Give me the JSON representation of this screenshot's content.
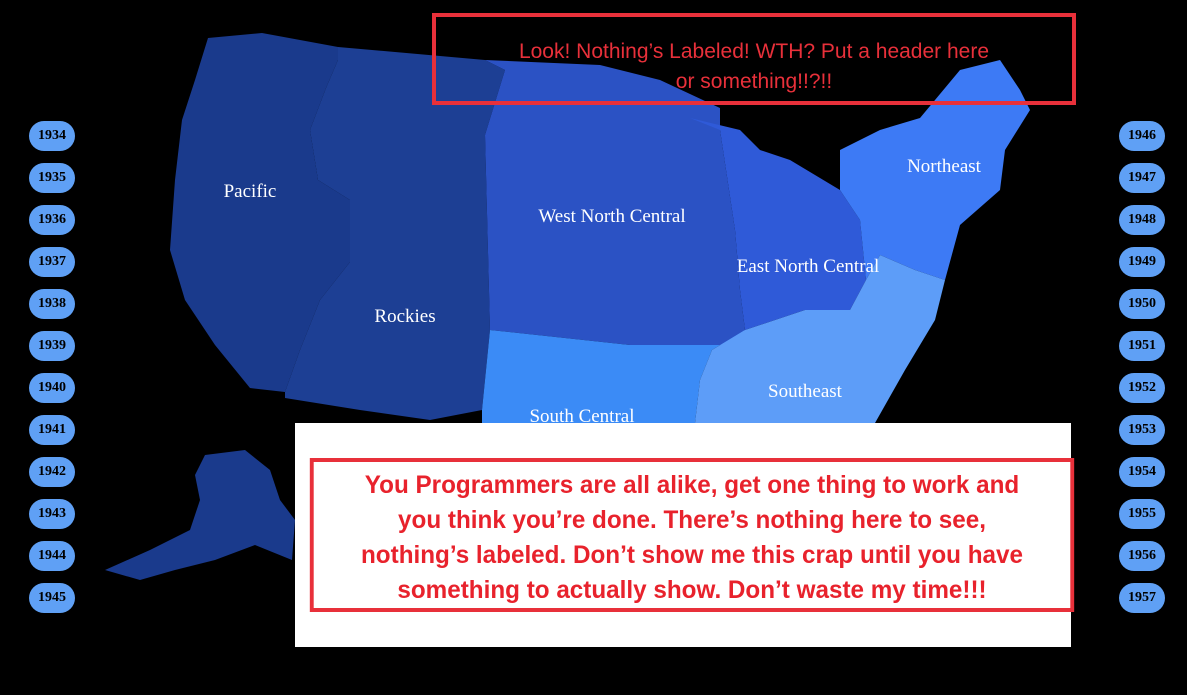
{
  "map": {
    "regions": [
      {
        "key": "pacific",
        "label": "Pacific",
        "color": "#1a3a8c"
      },
      {
        "key": "rockies",
        "label": "Rockies",
        "color": "#1d3f94"
      },
      {
        "key": "west_north_central",
        "label": "West North Central",
        "color": "#2b52c4"
      },
      {
        "key": "east_north_central",
        "label": "East North Central",
        "color": "#2f5ad8"
      },
      {
        "key": "northeast",
        "label": "Northeast",
        "color": "#3d7af5"
      },
      {
        "key": "south_central",
        "label": "South Central",
        "color": "#3b8bf6"
      },
      {
        "key": "southeast",
        "label": "Southeast",
        "color": "#5d9df8"
      },
      {
        "key": "alaska",
        "label": "",
        "color": "#1a3a8c"
      }
    ]
  },
  "years": {
    "left": [
      "1934",
      "1935",
      "1936",
      "1937",
      "1938",
      "1939",
      "1940",
      "1941",
      "1942",
      "1943",
      "1944",
      "1945"
    ],
    "right": [
      "1946",
      "1947",
      "1948",
      "1949",
      "1950",
      "1951",
      "1952",
      "1953",
      "1954",
      "1955",
      "1956",
      "1957"
    ],
    "button_color": "#5fa0f5"
  },
  "annotations": {
    "top": "Look! Nothing’s Labeled! WTH? Put a header here or something!!?!!",
    "bottom": "You Programmers are all alike, get one thing to work and you think you’re done. There’s nothing here to see, nothing’s labeled. Don’t show me this crap until you have something to actually show. Don’t waste my time!!!",
    "color": "#e8303a"
  }
}
